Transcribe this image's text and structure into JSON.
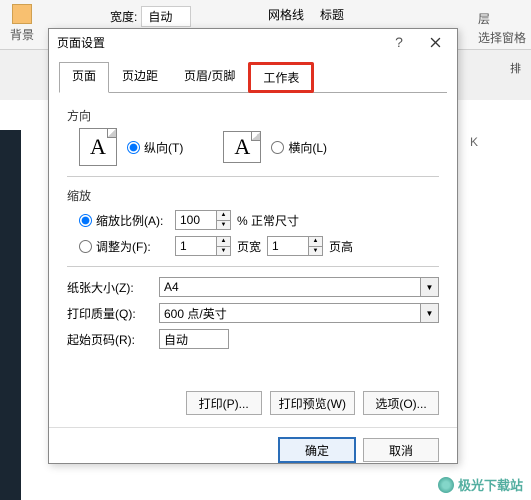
{
  "ribbon": {
    "bg_label": "背景",
    "width_label": "宽度:",
    "width_value": "自动",
    "grid_label": "网格线",
    "title_label": "标题",
    "layer_label": "层",
    "select_window": "选择窗格",
    "arrange": "排"
  },
  "dialog": {
    "title": "页面设置",
    "tabs": [
      "页面",
      "页边距",
      "页眉/页脚",
      "工作表"
    ],
    "orientation": {
      "label": "方向",
      "portrait": "纵向(T)",
      "landscape": "横向(L)"
    },
    "scale": {
      "label": "缩放",
      "ratio_label": "缩放比例(A):",
      "ratio_value": "100",
      "ratio_suffix": "% 正常尺寸",
      "fit_label": "调整为(F):",
      "fit_w": "1",
      "fit_w_suffix": "页宽",
      "fit_h": "1",
      "fit_h_suffix": "页高"
    },
    "paper": {
      "size_label": "纸张大小(Z):",
      "size_value": "A4",
      "quality_label": "打印质量(Q):",
      "quality_value": "600 点/英寸",
      "startpage_label": "起始页码(R):",
      "startpage_value": "自动"
    },
    "buttons": {
      "print": "打印(P)...",
      "preview": "打印预览(W)",
      "options": "选项(O)...",
      "ok": "确定",
      "cancel": "取消"
    }
  },
  "sheet": {
    "col": "K"
  },
  "watermark": "极光下载站"
}
